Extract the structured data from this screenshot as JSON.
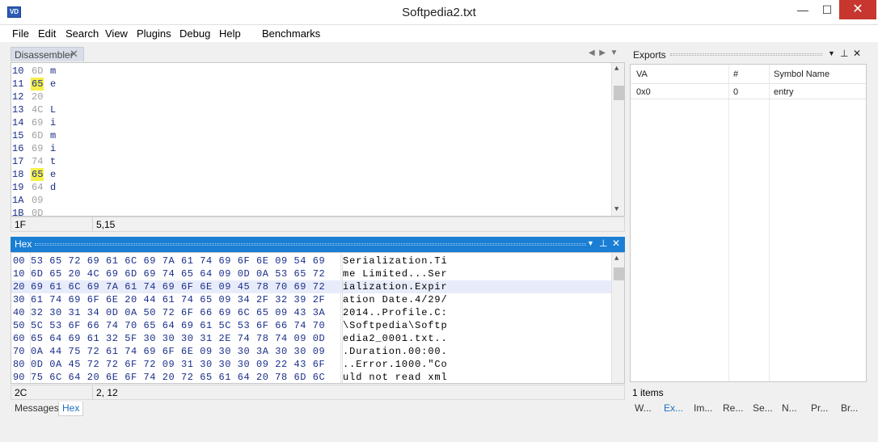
{
  "window": {
    "title": "Softpedia2.txt",
    "icon_label": "VD",
    "minimize_icon": "minimize-icon",
    "maximize_icon": "maximize-icon",
    "close_icon": "close-icon"
  },
  "menu": [
    "File",
    "Edit",
    "Search",
    "View",
    "Plugins",
    "Debug",
    "Help",
    "Benchmarks"
  ],
  "disassembler": {
    "tab_label": "Disassembler",
    "rows": [
      {
        "addr": "10",
        "hex": "6D",
        "chr": "m",
        "hl": false
      },
      {
        "addr": "11",
        "hex": "65",
        "chr": "e",
        "hl": true
      },
      {
        "addr": "12",
        "hex": "20",
        "chr": "",
        "hl": false
      },
      {
        "addr": "13",
        "hex": "4C",
        "chr": "L",
        "hl": false
      },
      {
        "addr": "14",
        "hex": "69",
        "chr": "i",
        "hl": false
      },
      {
        "addr": "15",
        "hex": "6D",
        "chr": "m",
        "hl": false
      },
      {
        "addr": "16",
        "hex": "69",
        "chr": "i",
        "hl": false
      },
      {
        "addr": "17",
        "hex": "74",
        "chr": "t",
        "hl": false
      },
      {
        "addr": "18",
        "hex": "65",
        "chr": "e",
        "hl": true
      },
      {
        "addr": "19",
        "hex": "64",
        "chr": "d",
        "hl": false
      },
      {
        "addr": "1A",
        "hex": "09",
        "chr": "",
        "hl": false
      },
      {
        "addr": "1B",
        "hex": "0D",
        "chr": "",
        "hl": false
      }
    ],
    "status": {
      "address": "1F",
      "position": "5,15"
    }
  },
  "hex": {
    "title": "Hex",
    "rows": [
      {
        "off": "00",
        "bytes": "53 65 72 69 61 6C 69 7A 61 74 69 6F 6E 09 54 69",
        "ascii": "Serialization.Ti"
      },
      {
        "off": "10",
        "bytes": "6D 65 20 4C 69 6D 69 74 65 64 09 0D 0A 53 65 72",
        "ascii": "me Limited...Ser"
      },
      {
        "off": "20",
        "bytes": "69 61 6C 69 7A 61 74 69 6F 6E 09 45 78 70 69 72",
        "ascii": "ialization.Expir"
      },
      {
        "off": "30",
        "bytes": "61 74 69 6F 6E 20 44 61 74 65 09 34 2F 32 39 2F",
        "ascii": "ation Date.4/29/"
      },
      {
        "off": "40",
        "bytes": "32 30 31 34 0D 0A 50 72 6F 66 69 6C 65 09 43 3A",
        "ascii": "2014..Profile.C:"
      },
      {
        "off": "50",
        "bytes": "5C 53 6F 66 74 70 65 64 69 61 5C 53 6F 66 74 70",
        "ascii": "\\Softpedia\\Softp"
      },
      {
        "off": "60",
        "bytes": "65 64 69 61 32 5F 30 30 30 31 2E 74 78 74 09 0D",
        "ascii": "edia2_0001.txt.."
      },
      {
        "off": "70",
        "bytes": "0A 44 75 72 61 74 69 6F 6E 09 30 30 3A 30 30 09",
        "ascii": ".Duration.00:00."
      },
      {
        "off": "80",
        "bytes": "0D 0A 45 72 72 6F 72 09 31 30 30 30 09 22 43 6F",
        "ascii": "..Error.1000.\"Co"
      },
      {
        "off": "90",
        "bytes": "75 6C 64 20 6E 6F 74 20 72 65 61 64 20 78 6D 6C",
        "ascii": "uld not read xml"
      }
    ],
    "selected_row": 2,
    "status": {
      "address": "2C",
      "position": "2, 12"
    }
  },
  "bottom_tabs": [
    "Messages",
    "Hex"
  ],
  "exports": {
    "title": "Exports",
    "columns": [
      "VA",
      "#",
      "Symbol Name"
    ],
    "rows": [
      {
        "va": "0x0",
        "num": "0",
        "name": "entry"
      }
    ],
    "status": "1 items"
  },
  "right_tabs": [
    "W...",
    "Ex...",
    "Im...",
    "Re...",
    "Se...",
    "N...",
    "Pr...",
    "Br..."
  ],
  "colors": {
    "accent": "#1a7fd4",
    "highlight": "#f5f047",
    "close": "#c7372f"
  }
}
